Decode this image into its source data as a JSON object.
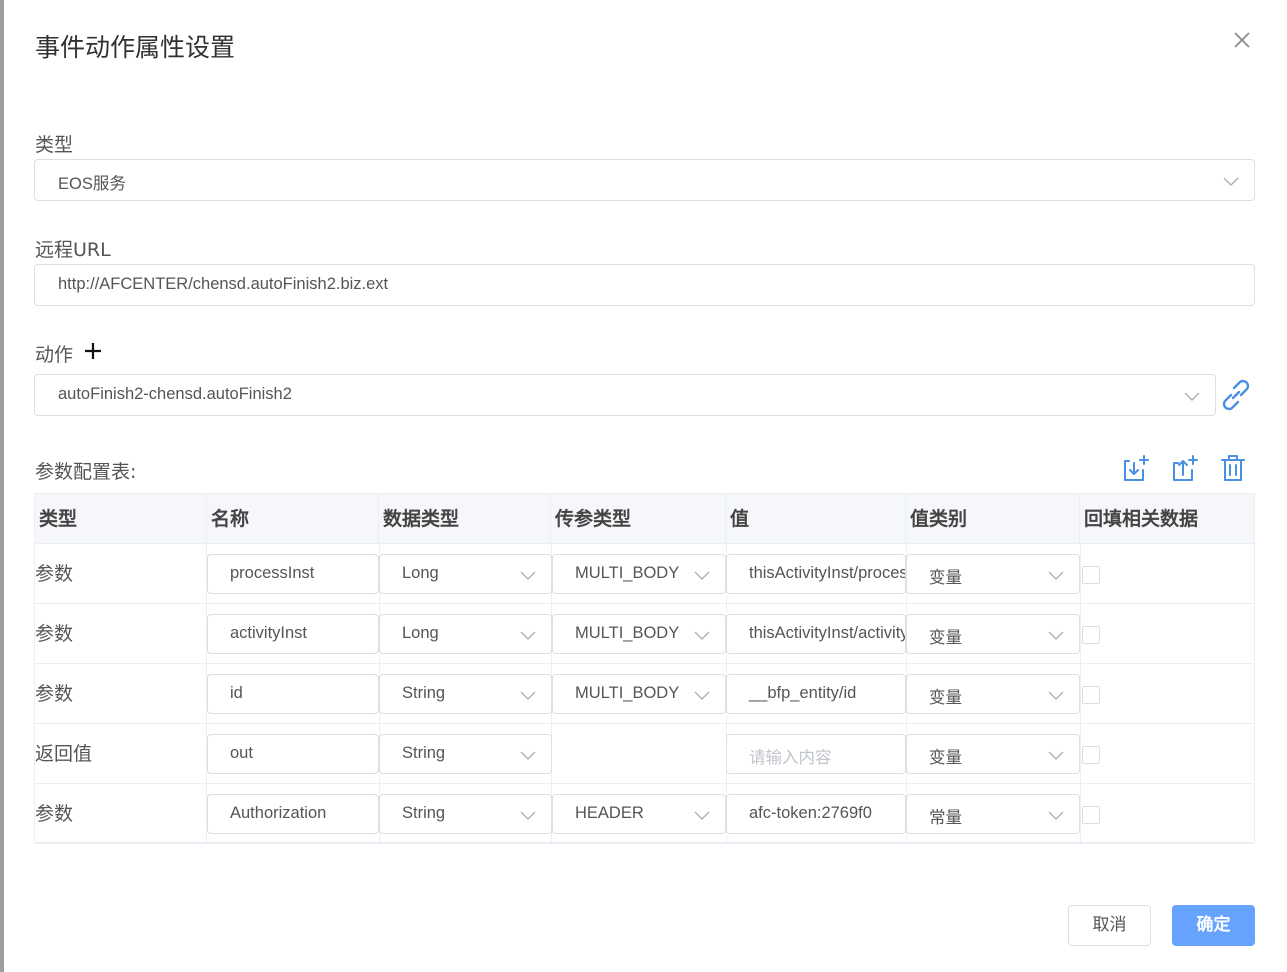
{
  "dialog": {
    "title": "事件动作属性设置",
    "close_icon": "close-icon"
  },
  "form": {
    "type_label": "类型",
    "type_value": "EOS服务",
    "url_label": "远程URL",
    "url_value": "http://AFCENTER/chensd.autoFinish2.biz.ext",
    "action_label": "动作",
    "action_value": "autoFinish2-chensd.autoFinish2",
    "params_label": "参数配置表:"
  },
  "table": {
    "columns": [
      "类型",
      "名称",
      "数据类型",
      "传参类型",
      "值",
      "值类别",
      "回填相关数据"
    ],
    "rows": [
      {
        "type": "参数",
        "name": "processInst",
        "data_type": "Long",
        "pass_type": "MULTI_BODY",
        "value": "thisActivityInst/processInstID",
        "value_is_placeholder": false,
        "value_class": "变量",
        "backfill": false
      },
      {
        "type": "参数",
        "name": "activityInst",
        "data_type": "Long",
        "pass_type": "MULTI_BODY",
        "value": "thisActivityInst/activityInstID",
        "value_is_placeholder": false,
        "value_class": "变量",
        "backfill": false
      },
      {
        "type": "参数",
        "name": "id",
        "data_type": "String",
        "pass_type": "MULTI_BODY",
        "value": "__bfp_entity/id",
        "value_is_placeholder": false,
        "value_class": "变量",
        "backfill": false
      },
      {
        "type": "返回值",
        "name": "out",
        "data_type": "String",
        "pass_type": "",
        "value": "请输入内容",
        "value_is_placeholder": true,
        "value_class": "变量",
        "backfill": false
      },
      {
        "type": "参数",
        "name": "Authorization",
        "data_type": "String",
        "pass_type": "HEADER",
        "value": "afc-token:2769f0",
        "value_is_placeholder": false,
        "value_class": "常量",
        "backfill": false
      }
    ]
  },
  "footer": {
    "cancel_label": "取消",
    "ok_label": "确定"
  },
  "colors": {
    "primary": "#66a3ff",
    "icon_blue": "#4a90e2",
    "border": "#dcdfe6"
  }
}
